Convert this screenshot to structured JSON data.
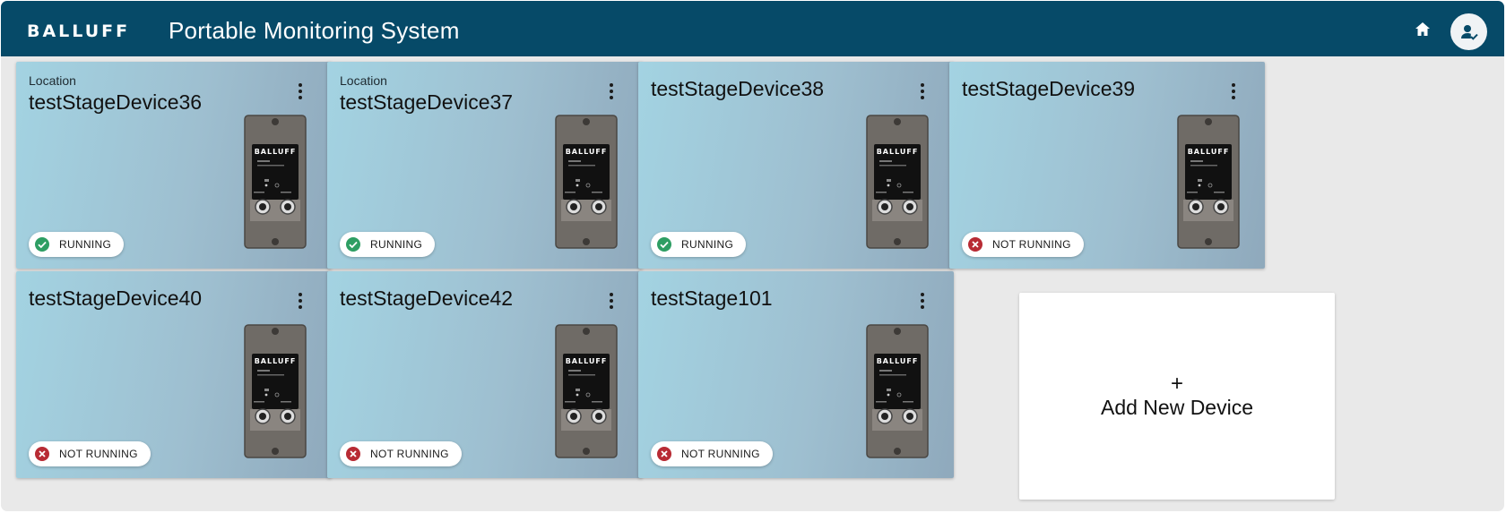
{
  "header": {
    "logo": "BALLUFF",
    "title": "Portable Monitoring System",
    "home_icon": "home-icon",
    "account_icon": "user-check-icon"
  },
  "colors": {
    "header_bg": "#064a68",
    "running": "#2e9e63",
    "not_running": "#b82b34"
  },
  "devices": [
    {
      "subtitle": "Location",
      "name": "testStageDevice36",
      "status": "RUNNING",
      "state": "running"
    },
    {
      "subtitle": "Location",
      "name": "testStageDevice37",
      "status": "RUNNING",
      "state": "running"
    },
    {
      "subtitle": "",
      "name": "testStageDevice38",
      "status": "RUNNING",
      "state": "running"
    },
    {
      "subtitle": "",
      "name": "testStageDevice39",
      "status": "NOT RUNNING",
      "state": "stopped"
    },
    {
      "subtitle": "",
      "name": "testStageDevice40",
      "status": "NOT RUNNING",
      "state": "stopped"
    },
    {
      "subtitle": "",
      "name": "testStageDevice42",
      "status": "NOT RUNNING",
      "state": "stopped"
    },
    {
      "subtitle": "",
      "name": "testStage101",
      "status": "NOT RUNNING",
      "state": "stopped"
    }
  ],
  "device_image": {
    "brand": "BALLUFF",
    "icon": "device-image"
  },
  "add_device": {
    "plus": "+",
    "label": "Add New Device"
  }
}
